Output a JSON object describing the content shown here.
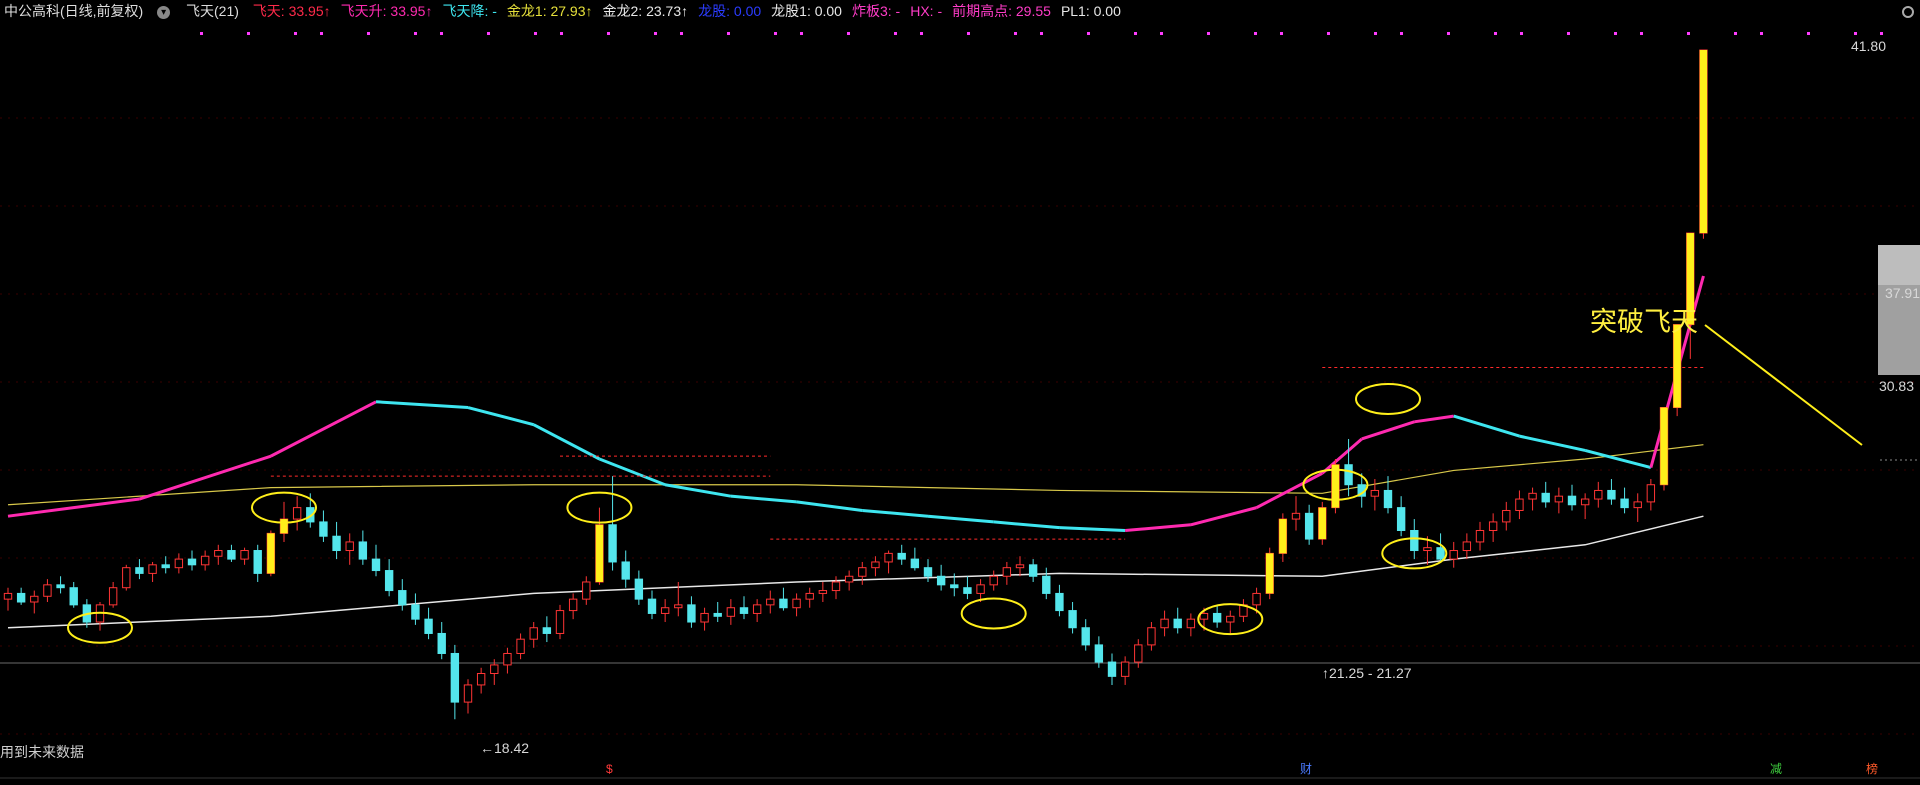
{
  "header": {
    "stock": "中公高科",
    "period": "(日线,前复权)",
    "indicator": "飞天(21)",
    "items": [
      {
        "label": "飞天: ",
        "value": "33.95",
        "color": "#ff2a4a",
        "arrow": "↑"
      },
      {
        "label": "飞天升: ",
        "value": "33.95",
        "color": "#ff2ab0",
        "arrow": "↑"
      },
      {
        "label": "飞天降: ",
        "value": "-",
        "color": "#3ee6f0",
        "arrow": ""
      },
      {
        "label": "金龙1: ",
        "value": "27.93",
        "color": "#e6e03a",
        "arrow": "↑"
      },
      {
        "label": "金龙2: ",
        "value": "23.73",
        "color": "#e8e8e8",
        "arrow": "↑"
      },
      {
        "label": "龙股: ",
        "value": "0.00",
        "color": "#2b3cff",
        "arrow": ""
      },
      {
        "label": "龙股1: ",
        "value": "0.00",
        "color": "#e8e8e8",
        "arrow": ""
      },
      {
        "label": "炸板3: ",
        "value": "-",
        "color": "#ff3cc8",
        "arrow": ""
      },
      {
        "label": "HX: ",
        "value": "-",
        "color": "#ff3cc8",
        "arrow": ""
      },
      {
        "label": "前期高点: ",
        "value": "29.55",
        "color": "#ff3cc8",
        "arrow": ""
      },
      {
        "label": "PL1: ",
        "value": "0.00",
        "color": "#e8e8e8",
        "arrow": ""
      }
    ]
  },
  "annotation": {
    "text": "突破飞天"
  },
  "footer": {
    "note": "用到未来数据"
  },
  "marks": {
    "low": "18.42",
    "range": "21.25 - 21.27",
    "s": "$",
    "cai": "财",
    "jian": "减",
    "bang": "榜"
  },
  "price_labels": [
    "41.80",
    "37.91",
    "30.83"
  ],
  "chart_data": {
    "type": "candlestick",
    "ylim": [
      17.5,
      42.5
    ],
    "xlim": [
      0,
      140
    ],
    "candles_ohlc": [
      [
        0,
        22.6,
        23.0,
        22.2,
        22.8
      ],
      [
        1,
        22.8,
        23.0,
        22.4,
        22.5
      ],
      [
        2,
        22.5,
        22.9,
        22.1,
        22.7
      ],
      [
        3,
        22.7,
        23.3,
        22.5,
        23.1
      ],
      [
        4,
        23.1,
        23.4,
        22.8,
        23.0
      ],
      [
        5,
        23.0,
        23.2,
        22.3,
        22.4
      ],
      [
        6,
        22.4,
        22.6,
        21.6,
        21.8
      ],
      [
        7,
        21.8,
        22.5,
        21.5,
        22.4
      ],
      [
        8,
        22.4,
        23.2,
        22.3,
        23.0
      ],
      [
        9,
        23.0,
        23.8,
        22.9,
        23.7
      ],
      [
        10,
        23.7,
        24.0,
        23.3,
        23.5
      ],
      [
        11,
        23.5,
        23.9,
        23.2,
        23.8
      ],
      [
        12,
        23.8,
        24.1,
        23.5,
        23.7
      ],
      [
        13,
        23.7,
        24.2,
        23.5,
        24.0
      ],
      [
        14,
        24.0,
        24.3,
        23.6,
        23.8
      ],
      [
        15,
        23.8,
        24.3,
        23.6,
        24.1
      ],
      [
        16,
        24.1,
        24.5,
        23.8,
        24.3
      ],
      [
        17,
        24.3,
        24.5,
        23.9,
        24.0
      ],
      [
        18,
        24.0,
        24.4,
        23.8,
        24.3
      ],
      [
        19,
        24.3,
        24.5,
        23.2,
        23.5
      ],
      [
        20,
        23.5,
        25.0,
        23.4,
        24.9
      ],
      [
        21,
        24.9,
        26.0,
        24.6,
        25.4
      ],
      [
        22,
        25.4,
        26.2,
        25.0,
        25.8
      ],
      [
        23,
        25.8,
        26.3,
        25.1,
        25.3
      ],
      [
        24,
        25.3,
        25.7,
        24.6,
        24.8
      ],
      [
        25,
        24.8,
        25.3,
        24.0,
        24.3
      ],
      [
        26,
        24.3,
        24.9,
        23.8,
        24.6
      ],
      [
        27,
        24.6,
        25.0,
        23.8,
        24.0
      ],
      [
        28,
        24.0,
        24.5,
        23.4,
        23.6
      ],
      [
        29,
        23.6,
        24.0,
        22.7,
        22.9
      ],
      [
        30,
        22.9,
        23.3,
        22.2,
        22.4
      ],
      [
        31,
        22.4,
        22.8,
        21.7,
        21.9
      ],
      [
        32,
        21.9,
        22.3,
        21.2,
        21.4
      ],
      [
        33,
        21.4,
        21.8,
        20.5,
        20.7
      ],
      [
        34,
        20.7,
        21.0,
        18.4,
        19.0
      ],
      [
        35,
        19.0,
        19.8,
        18.6,
        19.6
      ],
      [
        36,
        19.6,
        20.2,
        19.3,
        20.0
      ],
      [
        37,
        20.0,
        20.5,
        19.6,
        20.3
      ],
      [
        38,
        20.3,
        20.9,
        20.0,
        20.7
      ],
      [
        39,
        20.7,
        21.4,
        20.5,
        21.2
      ],
      [
        40,
        21.2,
        21.8,
        20.9,
        21.6
      ],
      [
        41,
        21.6,
        22.0,
        21.1,
        21.4
      ],
      [
        42,
        21.4,
        22.4,
        21.2,
        22.2
      ],
      [
        43,
        22.2,
        22.8,
        21.9,
        22.6
      ],
      [
        44,
        22.6,
        23.4,
        22.4,
        23.2
      ],
      [
        45,
        23.2,
        25.8,
        23.1,
        25.2
      ],
      [
        46,
        25.2,
        26.9,
        23.6,
        23.9
      ],
      [
        47,
        23.9,
        24.3,
        23.0,
        23.3
      ],
      [
        48,
        23.3,
        23.6,
        22.4,
        22.6
      ],
      [
        49,
        22.6,
        22.9,
        21.9,
        22.1
      ],
      [
        50,
        22.1,
        22.6,
        21.8,
        22.3
      ],
      [
        51,
        22.3,
        23.2,
        22.0,
        22.4
      ],
      [
        52,
        22.4,
        22.7,
        21.6,
        21.8
      ],
      [
        53,
        21.8,
        22.3,
        21.5,
        22.1
      ],
      [
        54,
        22.1,
        22.5,
        21.8,
        22.0
      ],
      [
        55,
        22.0,
        22.6,
        21.7,
        22.3
      ],
      [
        56,
        22.3,
        22.7,
        21.9,
        22.1
      ],
      [
        57,
        22.1,
        22.6,
        21.8,
        22.4
      ],
      [
        58,
        22.4,
        22.9,
        22.1,
        22.6
      ],
      [
        59,
        22.6,
        23.0,
        22.2,
        22.3
      ],
      [
        60,
        22.3,
        22.8,
        22.0,
        22.6
      ],
      [
        61,
        22.6,
        23.0,
        22.3,
        22.8
      ],
      [
        62,
        22.8,
        23.2,
        22.5,
        22.9
      ],
      [
        63,
        22.9,
        23.4,
        22.6,
        23.2
      ],
      [
        64,
        23.2,
        23.6,
        22.9,
        23.4
      ],
      [
        65,
        23.4,
        23.9,
        23.1,
        23.7
      ],
      [
        66,
        23.7,
        24.1,
        23.4,
        23.9
      ],
      [
        67,
        23.9,
        24.3,
        23.5,
        24.2
      ],
      [
        68,
        24.2,
        24.5,
        23.8,
        24.0
      ],
      [
        69,
        24.0,
        24.4,
        23.6,
        23.7
      ],
      [
        70,
        23.7,
        24.0,
        23.2,
        23.4
      ],
      [
        71,
        23.4,
        23.8,
        22.9,
        23.1
      ],
      [
        72,
        23.1,
        23.5,
        22.7,
        23.0
      ],
      [
        73,
        23.0,
        23.4,
        22.6,
        22.8
      ],
      [
        74,
        22.8,
        23.3,
        22.5,
        23.1
      ],
      [
        75,
        23.1,
        23.6,
        22.9,
        23.4
      ],
      [
        76,
        23.4,
        23.9,
        23.1,
        23.7
      ],
      [
        77,
        23.7,
        24.1,
        23.4,
        23.8
      ],
      [
        78,
        23.8,
        24.0,
        23.2,
        23.4
      ],
      [
        79,
        23.4,
        23.7,
        22.6,
        22.8
      ],
      [
        80,
        22.8,
        23.1,
        22.0,
        22.2
      ],
      [
        81,
        22.2,
        22.5,
        21.4,
        21.6
      ],
      [
        82,
        21.6,
        21.9,
        20.8,
        21.0
      ],
      [
        83,
        21.0,
        21.3,
        20.2,
        20.4
      ],
      [
        84,
        20.4,
        20.7,
        19.6,
        19.9
      ],
      [
        85,
        19.9,
        20.6,
        19.6,
        20.4
      ],
      [
        86,
        20.4,
        21.2,
        20.2,
        21.0
      ],
      [
        87,
        21.0,
        21.8,
        20.8,
        21.6
      ],
      [
        88,
        21.6,
        22.2,
        21.3,
        21.9
      ],
      [
        89,
        21.9,
        22.3,
        21.4,
        21.6
      ],
      [
        90,
        21.6,
        22.1,
        21.3,
        21.9
      ],
      [
        91,
        21.9,
        22.3,
        21.5,
        22.1
      ],
      [
        92,
        22.1,
        22.4,
        21.6,
        21.8
      ],
      [
        93,
        21.8,
        22.2,
        21.4,
        22.0
      ],
      [
        94,
        22.0,
        22.6,
        21.8,
        22.4
      ],
      [
        95,
        22.4,
        23.0,
        22.1,
        22.8
      ],
      [
        96,
        22.8,
        24.4,
        22.6,
        24.2
      ],
      [
        97,
        24.2,
        25.6,
        23.9,
        25.4
      ],
      [
        98,
        25.4,
        26.2,
        25.0,
        25.6
      ],
      [
        99,
        25.6,
        25.9,
        24.5,
        24.7
      ],
      [
        100,
        24.7,
        26.0,
        24.5,
        25.8
      ],
      [
        101,
        25.8,
        27.5,
        25.6,
        27.3
      ],
      [
        102,
        27.3,
        28.2,
        26.2,
        26.6
      ],
      [
        103,
        26.6,
        27.0,
        25.8,
        26.2
      ],
      [
        104,
        26.2,
        26.8,
        25.7,
        26.4
      ],
      [
        105,
        26.4,
        26.9,
        25.6,
        25.8
      ],
      [
        106,
        25.8,
        26.2,
        24.8,
        25.0
      ],
      [
        107,
        25.0,
        25.4,
        24.0,
        24.3
      ],
      [
        108,
        24.3,
        24.8,
        23.8,
        24.4
      ],
      [
        109,
        24.4,
        24.9,
        23.9,
        24.0
      ],
      [
        110,
        24.0,
        24.6,
        23.7,
        24.3
      ],
      [
        111,
        24.3,
        24.9,
        24.0,
        24.6
      ],
      [
        112,
        24.6,
        25.3,
        24.3,
        25.0
      ],
      [
        113,
        25.0,
        25.6,
        24.6,
        25.3
      ],
      [
        114,
        25.3,
        26.0,
        25.0,
        25.7
      ],
      [
        115,
        25.7,
        26.4,
        25.4,
        26.1
      ],
      [
        116,
        26.1,
        26.5,
        25.7,
        26.3
      ],
      [
        117,
        26.3,
        26.7,
        25.8,
        26.0
      ],
      [
        118,
        26.0,
        26.5,
        25.6,
        26.2
      ],
      [
        119,
        26.2,
        26.6,
        25.7,
        25.9
      ],
      [
        120,
        25.9,
        26.3,
        25.4,
        26.1
      ],
      [
        121,
        26.1,
        26.7,
        25.8,
        26.4
      ],
      [
        122,
        26.4,
        26.8,
        25.9,
        26.1
      ],
      [
        123,
        26.1,
        26.5,
        25.6,
        25.8
      ],
      [
        124,
        25.8,
        26.3,
        25.3,
        26.0
      ],
      [
        125,
        26.0,
        26.8,
        25.7,
        26.6
      ],
      [
        126,
        26.6,
        29.3,
        26.4,
        29.3
      ],
      [
        127,
        29.3,
        32.2,
        29.0,
        32.2
      ],
      [
        128,
        32.2,
        35.4,
        31.0,
        35.4
      ],
      [
        129,
        35.4,
        41.8,
        35.2,
        41.8
      ]
    ],
    "flytian_line": {
      "x": [
        0,
        10,
        20,
        28,
        35,
        40,
        45,
        50,
        55,
        60,
        65,
        70,
        75,
        80,
        85,
        90,
        95,
        100,
        103,
        107,
        110,
        115,
        120,
        125,
        129
      ],
      "y": [
        25.5,
        26.1,
        27.6,
        29.5,
        29.3,
        28.7,
        27.5,
        26.6,
        26.2,
        26.0,
        25.7,
        25.5,
        25.3,
        25.1,
        25.0,
        25.2,
        25.8,
        27.0,
        28.2,
        28.8,
        29.0,
        28.3,
        27.8,
        27.2,
        33.9
      ]
    },
    "golden_line": {
      "x": [
        0,
        20,
        40,
        60,
        80,
        100,
        110,
        120,
        129
      ],
      "y": [
        25.9,
        26.5,
        26.6,
        26.6,
        26.4,
        26.3,
        27.1,
        27.5,
        28.0
      ]
    },
    "white_line": {
      "x": [
        0,
        20,
        40,
        60,
        80,
        100,
        110,
        120,
        129
      ],
      "y": [
        21.6,
        22.0,
        22.8,
        23.2,
        23.5,
        23.4,
        24.0,
        24.5,
        25.5
      ]
    },
    "red_dash_levels": [
      {
        "y": 26.9,
        "x0": 20,
        "x1": 58
      },
      {
        "y": 27.6,
        "x0": 42,
        "x1": 58
      },
      {
        "y": 24.7,
        "x0": 58,
        "x1": 85
      },
      {
        "y": 30.7,
        "x0": 100,
        "x1": 129
      }
    ],
    "circles": [
      [
        7,
        21.6
      ],
      [
        21,
        25.8
      ],
      [
        45,
        25.8
      ],
      [
        75,
        22.1
      ],
      [
        93,
        21.9
      ],
      [
        101,
        26.6
      ],
      [
        107,
        24.2
      ],
      [
        105,
        29.6
      ]
    ],
    "y_ticks": [
      41.8,
      37.91,
      30.83
    ]
  }
}
